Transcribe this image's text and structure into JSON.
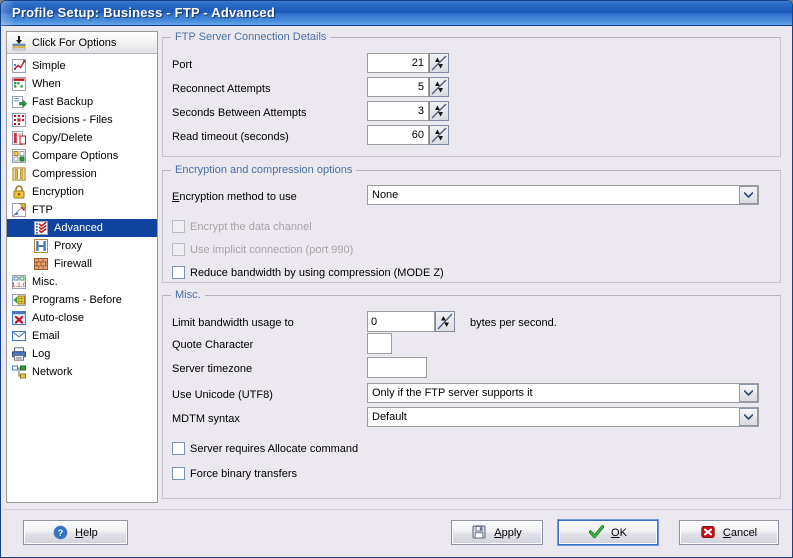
{
  "window": {
    "title": "Profile Setup: Business - FTP - Advanced"
  },
  "sidebar": {
    "header": {
      "label": "Click For Options",
      "icon": "options-list-icon"
    },
    "items": [
      {
        "label": "Simple",
        "icon": "simple-icon",
        "level": 0,
        "selected": false
      },
      {
        "label": "When",
        "icon": "when-icon",
        "level": 0,
        "selected": false
      },
      {
        "label": "Fast Backup",
        "icon": "fast-backup-icon",
        "level": 0,
        "selected": false
      },
      {
        "label": "Decisions - Files",
        "icon": "decisions-icon",
        "level": 0,
        "selected": false
      },
      {
        "label": "Copy/Delete",
        "icon": "copy-delete-icon",
        "level": 0,
        "selected": false
      },
      {
        "label": "Compare Options",
        "icon": "compare-icon",
        "level": 0,
        "selected": false
      },
      {
        "label": "Compression",
        "icon": "compression-icon",
        "level": 0,
        "selected": false
      },
      {
        "label": "Encryption",
        "icon": "lock-icon",
        "level": 0,
        "selected": false
      },
      {
        "label": "FTP",
        "icon": "ftp-icon",
        "level": 0,
        "selected": false
      },
      {
        "label": "Advanced",
        "icon": "advanced-icon",
        "level": 1,
        "selected": true
      },
      {
        "label": "Proxy",
        "icon": "proxy-icon",
        "level": 1,
        "selected": false
      },
      {
        "label": "Firewall",
        "icon": "firewall-icon",
        "level": 1,
        "selected": false
      },
      {
        "label": "Misc.",
        "icon": "misc-icon",
        "level": 0,
        "selected": false
      },
      {
        "label": "Programs - Before",
        "icon": "programs-icon",
        "level": 0,
        "selected": false
      },
      {
        "label": "Auto-close",
        "icon": "auto-close-icon",
        "level": 0,
        "selected": false
      },
      {
        "label": "Email",
        "icon": "email-icon",
        "level": 0,
        "selected": false
      },
      {
        "label": "Log",
        "icon": "log-icon",
        "level": 0,
        "selected": false
      },
      {
        "label": "Network",
        "icon": "network-icon",
        "level": 0,
        "selected": false
      }
    ]
  },
  "panel": {
    "connection_group": {
      "title": "FTP Server Connection Details",
      "fields": [
        {
          "label": "Port",
          "value": "21"
        },
        {
          "label": "Reconnect Attempts",
          "value": "5"
        },
        {
          "label": "Seconds Between Attempts",
          "value": "3"
        },
        {
          "label": "Read timeout (seconds)",
          "value": "60"
        }
      ]
    },
    "encryption_group": {
      "title": "Encryption and compression options",
      "method_label_prefix": "E",
      "method_label_rest": "ncryption method to use",
      "method_value": "None",
      "checkboxes": [
        {
          "label": "Encrypt the data channel",
          "checked": false,
          "disabled": true
        },
        {
          "label": "Use implicit connection (port 990)",
          "checked": false,
          "disabled": true
        },
        {
          "label": "Reduce bandwidth by using compression (MODE Z)",
          "checked": false,
          "disabled": false
        }
      ]
    },
    "misc_group": {
      "title": "Misc.",
      "limit_label": "Limit bandwidth usage to",
      "limit_value": "0",
      "limit_suffix": "bytes per second.",
      "quote_label": "Quote Character",
      "quote_value": "",
      "timezone_label": "Server timezone",
      "timezone_value": "",
      "unicode_label": "Use Unicode (UTF8)",
      "unicode_value": "Only if the FTP server supports it",
      "mdtm_label": "MDTM syntax",
      "mdtm_value": "Default",
      "checkboxes": [
        {
          "label": "Server requires Allocate command",
          "checked": false
        },
        {
          "label": "Force binary transfers",
          "checked": false
        }
      ]
    }
  },
  "buttons": {
    "help": {
      "accel": "H",
      "pre": "",
      "post": "elp",
      "icon": "help-icon"
    },
    "apply": {
      "accel": "A",
      "pre": "",
      "post": "pply",
      "icon": "save-icon"
    },
    "ok": {
      "accel": "O",
      "pre": "",
      "post": "K",
      "icon": "check-icon"
    },
    "cancel": {
      "accel": "C",
      "pre": "",
      "post": "ancel",
      "icon": "cancel-icon"
    }
  },
  "colors": {
    "title_bar": "#1e59bb",
    "selection": "#10439e",
    "group_title": "#4a6fa5",
    "background": "#ece8f0"
  }
}
